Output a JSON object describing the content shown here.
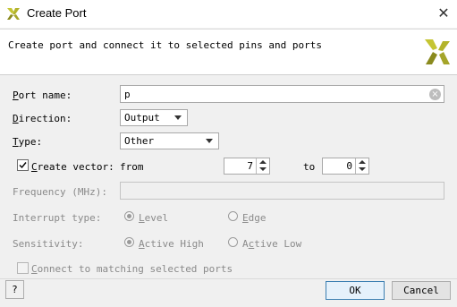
{
  "window": {
    "title": "Create Port",
    "close": "✕"
  },
  "header": {
    "description": "Create port and connect it to selected pins and ports"
  },
  "form": {
    "port_name": {
      "label_u": "P",
      "label_rest": "ort name:",
      "value": "p"
    },
    "direction": {
      "label_u": "D",
      "label_rest": "irection:",
      "value": "Output"
    },
    "type": {
      "label_u": "T",
      "label_rest": "ype:",
      "value": "Other"
    },
    "create_vector": {
      "label_u": "C",
      "label_rest": "reate vector:",
      "checked": true,
      "from_label": "from",
      "from_value": "7",
      "to_label": "to",
      "to_value": "0"
    },
    "frequency": {
      "label": "Frequency (MHz):",
      "value": ""
    },
    "interrupt_type": {
      "label": "Interrupt type:",
      "option1_u": "L",
      "option1_rest": "evel",
      "option2_u": "E",
      "option2_rest": "dge"
    },
    "sensitivity": {
      "label": "Sensitivity:",
      "option1_u": "A",
      "option1_rest": "ctive High",
      "option2_pre": "A",
      "option2_u": "c",
      "option2_rest": "tive Low"
    },
    "connect": {
      "label_u": "C",
      "label_rest": "onnect to matching selected ports"
    }
  },
  "footer": {
    "help": "?",
    "ok": "OK",
    "cancel": "Cancel"
  },
  "colors": {
    "logo_yellow": "#c5c533",
    "logo_olive": "#8a8a1e",
    "accent_border": "#3c7fb1"
  }
}
